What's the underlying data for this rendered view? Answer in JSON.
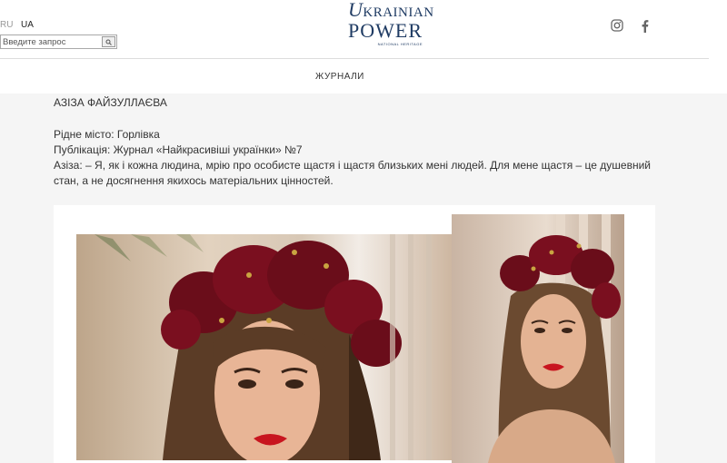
{
  "header": {
    "languages": [
      "RU",
      "UA"
    ],
    "search": {
      "placeholder": "Введите запрос"
    },
    "logo": {
      "line1_first": "U",
      "line1_rest": "KRAINIAN",
      "line2": "POWER",
      "line3": "NATIONAL HERITAGE"
    },
    "social": [
      "instagram-icon",
      "facebook-icon"
    ]
  },
  "nav": {
    "items": [
      "ЖУРНАЛИ"
    ]
  },
  "article": {
    "name": "АЗІЗА ФАЙЗУЛЛАЄВА",
    "hometown": "Рідне місто: Горлівка",
    "publication": "Публікація: Журнал «Найкрасивіші українки» №7",
    "quote": "Азіза: – Я, як і кожна людина, мрію про особисте щастя і щастя близьких мені людей. Для мене щастя – це душевний стан, а не досягнення якихось матеріальних цінностей."
  },
  "colors": {
    "brand": "#1f3b63",
    "flowers": "#7a0f1f",
    "lips": "#c8151f",
    "hair": "#5b3c26"
  }
}
